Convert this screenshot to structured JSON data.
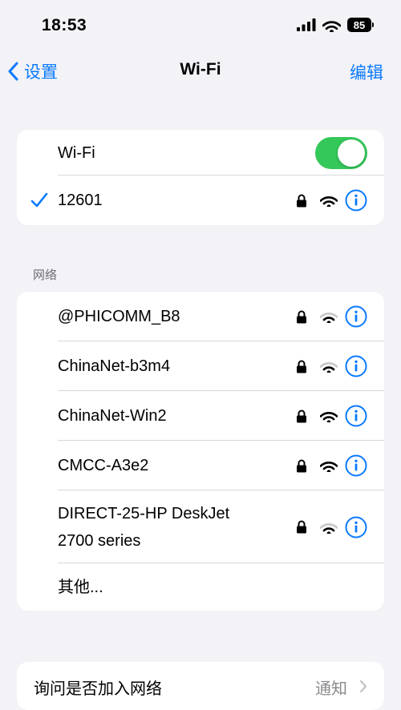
{
  "status_bar": {
    "time": "18:53",
    "battery": "85"
  },
  "nav": {
    "back_label": "设置",
    "title": "Wi-Fi",
    "edit_label": "编辑"
  },
  "wifi_group": {
    "toggle_label": "Wi-Fi",
    "toggle_on": true,
    "connected_network": {
      "name": "12601",
      "locked": true,
      "signal": "full"
    }
  },
  "networks_section": {
    "header": "网络",
    "networks": [
      {
        "name": "@PHICOMM_B8",
        "locked": true,
        "signal": "weak"
      },
      {
        "name": "ChinaNet-b3m4",
        "locked": true,
        "signal": "weak"
      },
      {
        "name": "ChinaNet-Win2",
        "locked": true,
        "signal": "full"
      },
      {
        "name": "CMCC-A3e2",
        "locked": true,
        "signal": "full"
      },
      {
        "name_line1": "DIRECT-25-HP DeskJet",
        "name_line2": "2700 series",
        "locked": true,
        "signal": "weak"
      }
    ],
    "other_label": "其他..."
  },
  "ask_join": {
    "label": "询问是否加入网络",
    "value": "通知"
  },
  "colors": {
    "accent": "#0a7aff",
    "toggle_on": "#34c759",
    "background": "#f2f2f7",
    "weak_signal": "#c7c7cc"
  }
}
